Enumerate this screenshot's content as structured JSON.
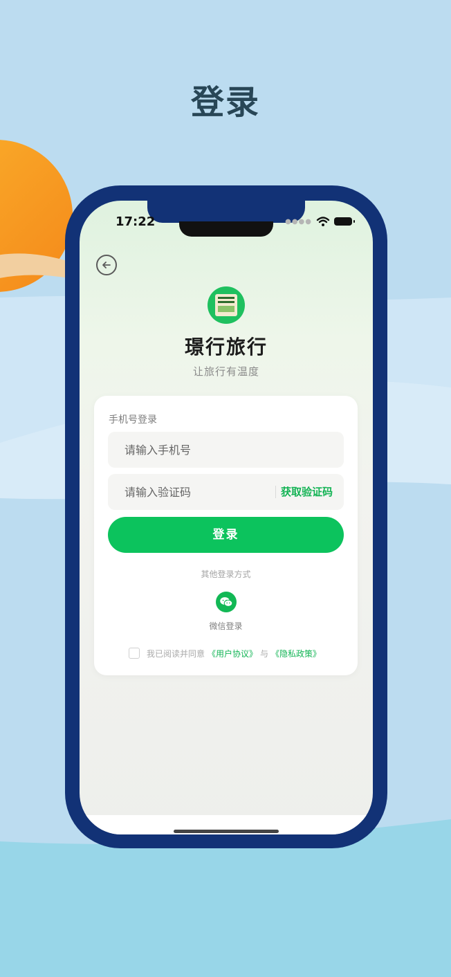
{
  "page": {
    "title": "登录"
  },
  "status_bar": {
    "time": "17:22"
  },
  "app": {
    "name": "璟行旅行",
    "slogan": "让旅行有温度"
  },
  "login_form": {
    "section_label": "手机号登录",
    "phone_placeholder": "请输入手机号",
    "code_placeholder": "请输入验证码",
    "get_code_label": "获取验证码",
    "login_button_label": "登录"
  },
  "other_login": {
    "title": "其他登录方式",
    "wechat_label": "微信登录"
  },
  "agreement": {
    "prefix": "我已阅读并同意",
    "user_agreement": "《用户协议》",
    "connector": "与",
    "privacy_policy": "《隐私政策》",
    "checked": false
  },
  "colors": {
    "accent_green": "#0cc35d",
    "phone_frame": "#123276",
    "background_sky": "#bcdcf0",
    "sun": "#f99a22"
  },
  "icons": [
    "back-arrow-icon",
    "wifi-icon",
    "battery-icon",
    "wechat-icon",
    "app-logo"
  ]
}
